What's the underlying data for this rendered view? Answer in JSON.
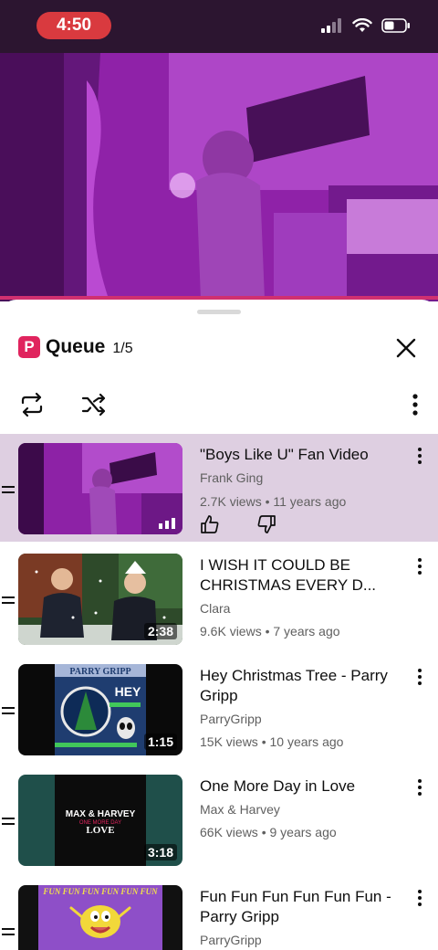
{
  "status_bar": {
    "time": "4:50"
  },
  "queue": {
    "title": "Queue",
    "count": "1/5"
  },
  "items": [
    {
      "title": "\"Boys Like U\" Fan Video",
      "channel": "Frank Ging",
      "meta": "2.7K views • 11 years ago",
      "duration": ""
    },
    {
      "title": "I WISH IT COULD BE CHRISTMAS EVERY D...",
      "channel": "Clara",
      "meta": "9.6K views • 7 years ago",
      "duration": "2:38"
    },
    {
      "title": "Hey Christmas Tree - Parry Gripp",
      "channel": "ParryGripp",
      "meta": "15K views • 10 years ago",
      "duration": "1:15"
    },
    {
      "title": "One More Day in Love",
      "channel": "Max & Harvey",
      "meta": "66K views • 9 years ago",
      "duration": "3:18"
    },
    {
      "title": "Fun Fun Fun Fun Fun Fun - Parry Gripp",
      "channel": "ParryGripp",
      "meta": "",
      "duration": ""
    }
  ],
  "thumb_text": {
    "parry_gripp": "PARRY GRIPP",
    "hey": "HEY",
    "max_harvey": "MAX & HARVEY",
    "one_more_day": "ONE MORE DAY",
    "love": "LOVE",
    "fun_banner": "FUN FUN FUN FUN FUN FUN"
  },
  "colors": {
    "accent": "#e0245e",
    "active_row": "#decfe1",
    "video_tint": "#8a1fa0"
  }
}
